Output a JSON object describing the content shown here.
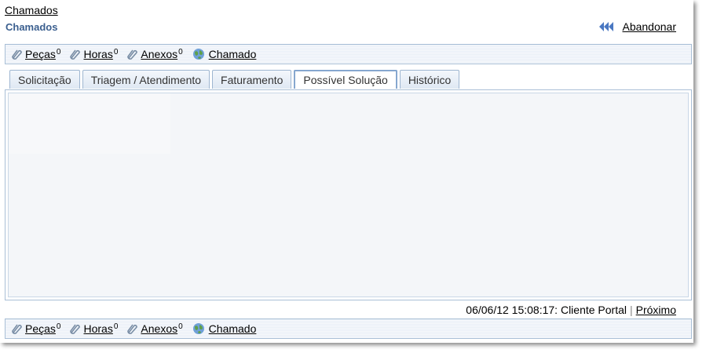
{
  "breadcrumb": "Chamados",
  "title": "Chamados",
  "abandon_label": "Abandonar",
  "toolbar": {
    "pecas": {
      "label": "Peças",
      "count": "0"
    },
    "horas": {
      "label": "Horas",
      "count": "0"
    },
    "anexos": {
      "label": "Anexos",
      "count": "0"
    },
    "chamado": {
      "label": "Chamado"
    }
  },
  "tabs": [
    "Solicitação",
    "Triagem / Atendimento",
    "Faturamento",
    "Possível Solução",
    "Histórico"
  ],
  "active_tab": "Possível Solução",
  "status": {
    "text": "06/06/12 15:08:17: Cliente Portal",
    "separator": "|",
    "next_label": "Próximo"
  },
  "colors": {
    "title": "#3b5f8f",
    "accent": "#4a78c2",
    "border": "#a9bfd6"
  },
  "icons": [
    "paperclip-icon",
    "globe-icon",
    "rewind-icon"
  ]
}
